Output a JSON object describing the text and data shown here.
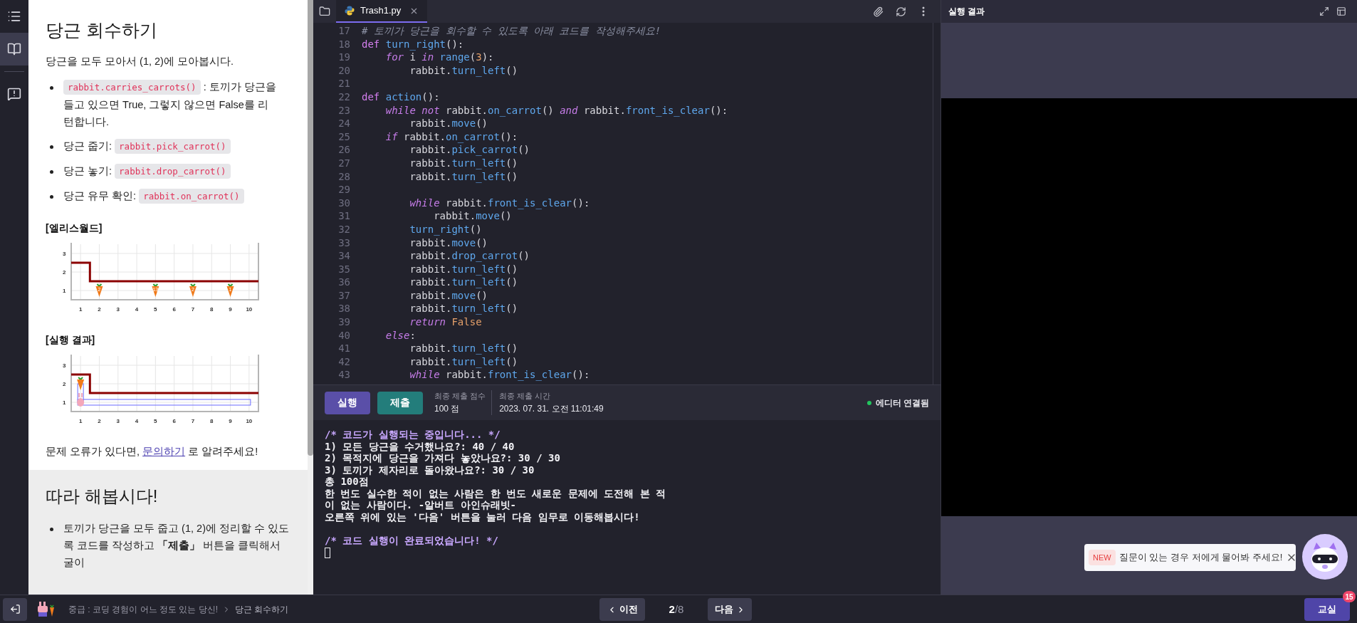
{
  "rail": [
    {
      "kind": "list",
      "selected": false
    },
    {
      "kind": "book",
      "selected": true
    },
    {
      "kind": "chat",
      "selected": false
    }
  ],
  "lesson": {
    "title": "당근 회수하기",
    "intro": "당근을 모두 모아서 (1, 2)에 모아봅시다.",
    "bullets": [
      {
        "parts": [
          {
            "kind": "code",
            "text": "rabbit.carries_carrots()"
          },
          {
            "kind": "text",
            "text": " : 토끼가 당근을 들고 있으면 True, 그렇지 않으면 False를 리턴합니다."
          }
        ]
      },
      {
        "parts": [
          {
            "kind": "text",
            "text": "당근 줍기: "
          },
          {
            "kind": "code",
            "text": "rabbit.pick_carrot()"
          }
        ]
      },
      {
        "parts": [
          {
            "kind": "text",
            "text": "당근 놓기: "
          },
          {
            "kind": "code",
            "text": "rabbit.drop_carrot()"
          }
        ]
      },
      {
        "parts": [
          {
            "kind": "text",
            "text": "당근 유무 확인: "
          },
          {
            "kind": "code",
            "text": "rabbit.on_carrot()"
          }
        ]
      }
    ],
    "figures": [
      {
        "caption": "[엘리스월드]",
        "kind": "start",
        "y_labels": [
          "3",
          "2",
          "1"
        ],
        "x_labels": [
          "1",
          "2",
          "3",
          "4",
          "5",
          "6",
          "7",
          "8",
          "9",
          "10"
        ],
        "carrots": [
          {
            "label": "2"
          },
          {
            "label": "13"
          },
          {
            "label": "2"
          },
          {
            "label": "1"
          }
        ]
      },
      {
        "caption": "[실행 결과]",
        "kind": "result",
        "y_labels": [
          "3",
          "2",
          "1"
        ],
        "x_labels": [
          "1",
          "2",
          "3",
          "4",
          "5",
          "6",
          "7",
          "8",
          "9",
          "10"
        ]
      }
    ],
    "help": {
      "before": "문제 오류가 있다면, ",
      "link": "문의하기",
      "after": " 로 알려주세요!"
    },
    "follow": {
      "title": "따라 해봅시다!",
      "bullets": [
        "토끼가 당근을 모두 줍고 (1, 2)에 정리할 수 있도록 코드를 작성하고 **「제출」** 버튼을 클릭해서 굴이"
      ]
    }
  },
  "editor": {
    "tabs": [
      {
        "label": "Trash1.py",
        "selected": true
      }
    ],
    "lines": [
      {
        "number": "17",
        "tokens": [
          {
            "kind": "comment",
            "text": "# 토끼가 당근을 회수할 수 있도록 아래 코드를 작성해주세요!"
          }
        ]
      },
      {
        "number": "18",
        "tokens": [
          {
            "kind": "def",
            "text": "def "
          },
          {
            "kind": "function",
            "text": "turn_right"
          },
          {
            "kind": "plain",
            "text": "():"
          }
        ]
      },
      {
        "number": "19",
        "tokens": [
          {
            "kind": "keyword",
            "text": "    for"
          },
          {
            "kind": "plain",
            "text": " i "
          },
          {
            "kind": "keyword",
            "text": "in "
          },
          {
            "kind": "function",
            "text": "range"
          },
          {
            "kind": "plain",
            "text": "("
          },
          {
            "kind": "number",
            "text": "3"
          },
          {
            "kind": "plain",
            "text": "):"
          }
        ]
      },
      {
        "number": "20",
        "tokens": [
          {
            "kind": "plain",
            "text": "        rabbit."
          },
          {
            "kind": "function",
            "text": "turn_left"
          },
          {
            "kind": "plain",
            "text": "()"
          }
        ]
      },
      {
        "number": "21"
      },
      {
        "number": "22",
        "tokens": [
          {
            "kind": "def",
            "text": "def "
          },
          {
            "kind": "function",
            "text": "action"
          },
          {
            "kind": "plain",
            "text": "():"
          }
        ]
      },
      {
        "number": "23",
        "tokens": [
          {
            "kind": "keyword",
            "text": "    while not"
          },
          {
            "kind": "plain",
            "text": " rabbit."
          },
          {
            "kind": "function",
            "text": "on_carrot"
          },
          {
            "kind": "plain",
            "text": "() "
          },
          {
            "kind": "keyword",
            "text": "and"
          },
          {
            "kind": "plain",
            "text": " rabbit."
          },
          {
            "kind": "function",
            "text": "front_is_clear"
          },
          {
            "kind": "plain",
            "text": "():"
          }
        ]
      },
      {
        "number": "24",
        "tokens": [
          {
            "kind": "plain",
            "text": "        rabbit."
          },
          {
            "kind": "function",
            "text": "move"
          },
          {
            "kind": "plain",
            "text": "()"
          }
        ]
      },
      {
        "number": "25",
        "tokens": [
          {
            "kind": "keyword",
            "text": "    if"
          },
          {
            "kind": "plain",
            "text": " rabbit."
          },
          {
            "kind": "function",
            "text": "on_carrot"
          },
          {
            "kind": "plain",
            "text": "():"
          }
        ]
      },
      {
        "number": "26",
        "tokens": [
          {
            "kind": "plain",
            "text": "        rabbit."
          },
          {
            "kind": "function",
            "text": "pick_carrot"
          },
          {
            "kind": "plain",
            "text": "()"
          }
        ]
      },
      {
        "number": "27",
        "tokens": [
          {
            "kind": "plain",
            "text": "        rabbit."
          },
          {
            "kind": "function",
            "text": "turn_left"
          },
          {
            "kind": "plain",
            "text": "()"
          }
        ]
      },
      {
        "number": "28",
        "tokens": [
          {
            "kind": "plain",
            "text": "        rabbit."
          },
          {
            "kind": "function",
            "text": "turn_left"
          },
          {
            "kind": "plain",
            "text": "()"
          }
        ]
      },
      {
        "number": "29"
      },
      {
        "number": "30",
        "tokens": [
          {
            "kind": "keyword",
            "text": "        while"
          },
          {
            "kind": "plain",
            "text": " rabbit."
          },
          {
            "kind": "function",
            "text": "front_is_clear"
          },
          {
            "kind": "plain",
            "text": "():"
          }
        ]
      },
      {
        "number": "31",
        "tokens": [
          {
            "kind": "plain",
            "text": "            rabbit."
          },
          {
            "kind": "function",
            "text": "move"
          },
          {
            "kind": "plain",
            "text": "()"
          }
        ]
      },
      {
        "number": "32",
        "tokens": [
          {
            "kind": "function",
            "text": "        turn_right"
          },
          {
            "kind": "plain",
            "text": "()"
          }
        ]
      },
      {
        "number": "33",
        "tokens": [
          {
            "kind": "plain",
            "text": "        rabbit."
          },
          {
            "kind": "function",
            "text": "move"
          },
          {
            "kind": "plain",
            "text": "()"
          }
        ]
      },
      {
        "number": "34",
        "tokens": [
          {
            "kind": "plain",
            "text": "        rabbit."
          },
          {
            "kind": "function",
            "text": "drop_carrot"
          },
          {
            "kind": "plain",
            "text": "()"
          }
        ]
      },
      {
        "number": "35",
        "tokens": [
          {
            "kind": "plain",
            "text": "        rabbit."
          },
          {
            "kind": "function",
            "text": "turn_left"
          },
          {
            "kind": "plain",
            "text": "()"
          }
        ]
      },
      {
        "number": "36",
        "tokens": [
          {
            "kind": "plain",
            "text": "        rabbit."
          },
          {
            "kind": "function",
            "text": "turn_left"
          },
          {
            "kind": "plain",
            "text": "()"
          }
        ]
      },
      {
        "number": "37",
        "tokens": [
          {
            "kind": "plain",
            "text": "        rabbit."
          },
          {
            "kind": "function",
            "text": "move"
          },
          {
            "kind": "plain",
            "text": "()"
          }
        ]
      },
      {
        "number": "38",
        "tokens": [
          {
            "kind": "plain",
            "text": "        rabbit."
          },
          {
            "kind": "function",
            "text": "turn_left"
          },
          {
            "kind": "plain",
            "text": "()"
          }
        ]
      },
      {
        "number": "39",
        "tokens": [
          {
            "kind": "keyword",
            "text": "        return "
          },
          {
            "kind": "constant",
            "text": "False"
          }
        ]
      },
      {
        "number": "40",
        "tokens": [
          {
            "kind": "keyword",
            "text": "    else"
          },
          {
            "kind": "plain",
            "text": ":"
          }
        ]
      },
      {
        "number": "41",
        "tokens": [
          {
            "kind": "plain",
            "text": "        rabbit."
          },
          {
            "kind": "function",
            "text": "turn_left"
          },
          {
            "kind": "plain",
            "text": "()"
          }
        ]
      },
      {
        "number": "42",
        "tokens": [
          {
            "kind": "plain",
            "text": "        rabbit."
          },
          {
            "kind": "function",
            "text": "turn_left"
          },
          {
            "kind": "plain",
            "text": "()"
          }
        ]
      },
      {
        "number": "43",
        "tokens": [
          {
            "kind": "keyword",
            "text": "        while"
          },
          {
            "kind": "plain",
            "text": " rabbit."
          },
          {
            "kind": "function",
            "text": "front_is_clear"
          },
          {
            "kind": "plain",
            "text": "():"
          }
        ]
      }
    ]
  },
  "runbar": {
    "run": "실행",
    "submit": "제출",
    "score_label": "최종 제출 점수",
    "score": "100 점",
    "time_label": "최종 제출 시간",
    "time": "2023. 07. 31. 오전 11:01:49",
    "connection": {
      "text": "에디터 연결됨",
      "color": "#22c55e"
    }
  },
  "console": [
    {
      "kind": "comment",
      "text": "/* 코드가 실행되는 중입니다... */"
    },
    {
      "kind": "text",
      "text": "1) 모든 당근을 수거했나요?: 40 / 40"
    },
    {
      "kind": "text",
      "text": "2) 목적지에 당근을 가져다 놓았나요?: 30 / 30"
    },
    {
      "kind": "text",
      "text": "3) 토끼가 제자리로 돌아왔나요?: 30 / 30"
    },
    {
      "kind": "text",
      "text": "총 100점"
    },
    {
      "kind": "text",
      "text": "한 번도 실수한 적이 없는 사람은 한 번도 새로운 문제에 도전해 본 적"
    },
    {
      "kind": "text",
      "text": "이 없는 사람이다. -알버트 아인슈래빗-"
    },
    {
      "kind": "text",
      "text": "오른쪽 위에 있는 '다음' 버튼을 눌러 다음 임무로 이동해봅시다!"
    },
    {
      "kind": "blank"
    },
    {
      "kind": "comment",
      "text": "/* 코드 실행이 완료되었습니다! */"
    },
    {
      "kind": "cursor"
    }
  ],
  "result": {
    "title": "실행 결과"
  },
  "chat_popup": {
    "badge": "NEW",
    "text": "질문이 있는 경우 저에게 물어봐 주세요!"
  },
  "footer": {
    "breadcrumb": [
      "중급 : 코딩 경험이 어느 정도 있는 당신!",
      "당근 회수하기"
    ],
    "prev": "이전",
    "page_current": "2",
    "page_rest": "/8",
    "next": "다음",
    "classroom": "교실",
    "classroom_badge": "15"
  }
}
